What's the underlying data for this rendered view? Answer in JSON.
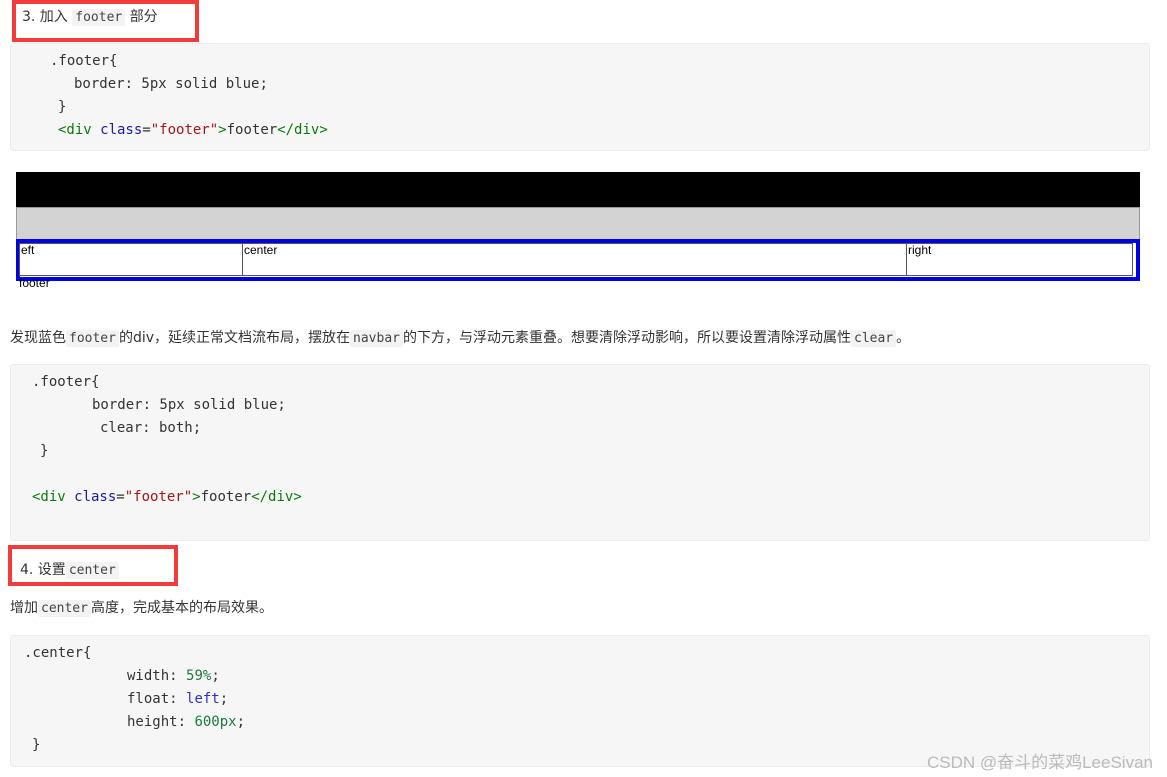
{
  "section3": {
    "heading_prefix": "3. 加入",
    "heading_code": "footer",
    "heading_suffix": "部分"
  },
  "code1": {
    "line1": ".footer{",
    "line2_prop": "border",
    "line2_val": ": 5px solid blue;",
    "line3": "}",
    "line4_open": "<div",
    "line4_attr": " class",
    "line4_eq": "=",
    "line4_str": "\"footer\"",
    "line4_gt": ">",
    "line4_text": "footer",
    "line4_close": "</div>"
  },
  "demo": {
    "left": "eft",
    "center": "center",
    "right": "right",
    "footer": "footer"
  },
  "para1": {
    "t1": "发现蓝色",
    "c1": "footer",
    "t2": "的div，延续正常文档流布局，摆放在",
    "c2": "navbar",
    "t3": "的下方，与浮动元素重叠。想要清除浮动影响，所以要设置清除浮动属性",
    "c3": "clear",
    "t4": "。"
  },
  "code2": {
    "line1": ".footer{",
    "line2": "border: 5px solid blue;",
    "line3": "clear: both;",
    "line4": "}",
    "line5_open": "<div",
    "line5_attr": " class",
    "line5_eq": "=",
    "line5_str": "\"footer\"",
    "line5_gt": ">",
    "line5_text": "footer",
    "line5_close": "</div>"
  },
  "section4": {
    "heading_prefix": "4. 设置",
    "heading_code": "center"
  },
  "para2": {
    "t1": "增加",
    "c1": "center",
    "t2": "高度，完成基本的布局效果。"
  },
  "code3": {
    "line1": ".center{",
    "w_prop": "width",
    "w_val": "59%",
    "f_prop": "float",
    "f_val": "left",
    "h_prop": "height",
    "h_val": "600px",
    "line5": "}"
  },
  "watermark": "CSDN @奋斗的菜鸡LeeSivan",
  "colors": {
    "highlight_border": "#f23b3b",
    "footer_border": "#0000e0",
    "navbar": "#000000",
    "subnav": "#d3d3d3"
  }
}
